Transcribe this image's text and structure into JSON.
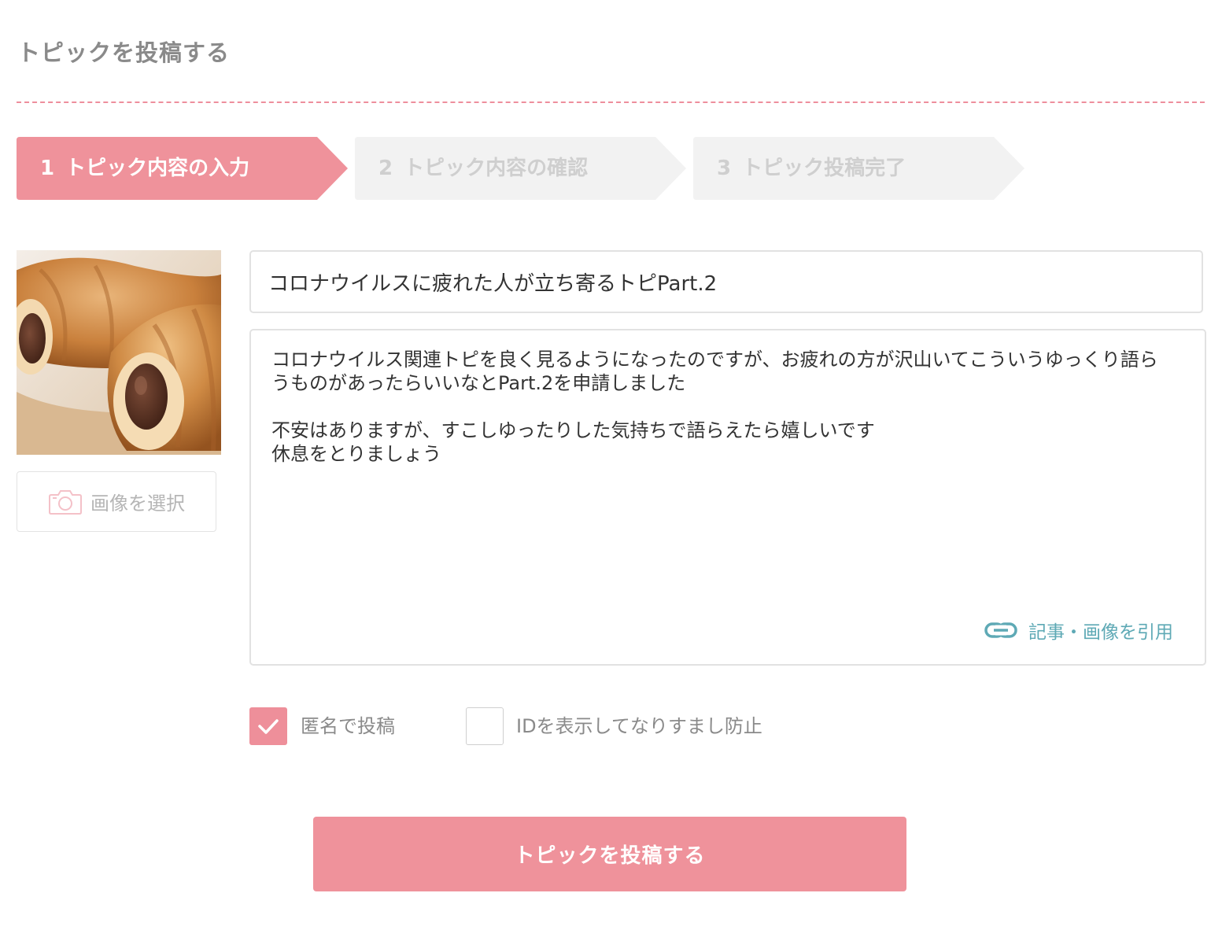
{
  "header": {
    "title": "トピックを投稿する"
  },
  "steps": [
    {
      "number": "1",
      "label": "トピック内容の入力",
      "state": "active"
    },
    {
      "number": "2",
      "label": "トピック内容の確認",
      "state": "inactive"
    },
    {
      "number": "3",
      "label": "トピック投稿完了",
      "state": "inactive"
    }
  ],
  "image_panel": {
    "select_label": "画像を選択",
    "select_icon": "camera-icon"
  },
  "form": {
    "title_value": "コロナウイルスに疲れた人が立ち寄るトピPart.2",
    "body_value": "コロナウイルス関連トピを良く見るようになったのですが、お疲れの方が沢山いてこういうゆっくり語らうものがあったらいいなとPart.2を申請しました\n\n不安はありますが、すこしゆったりした気持ちで語らえたら嬉しいです\n休息をとりましょう",
    "quote_label": "記事・画像を引用",
    "quote_icon": "link-icon"
  },
  "options": {
    "anonymous_label": "匿名で投稿",
    "anonymous_checked": true,
    "show_id_label": "IDを表示してなりすまし防止",
    "show_id_checked": false
  },
  "submit": {
    "label": "トピックを投稿する"
  },
  "colors": {
    "accent": "#ef929b",
    "step_inactive": "#f2f2f2",
    "divider": "#ee8f9d",
    "link": "#5ea9b5"
  }
}
